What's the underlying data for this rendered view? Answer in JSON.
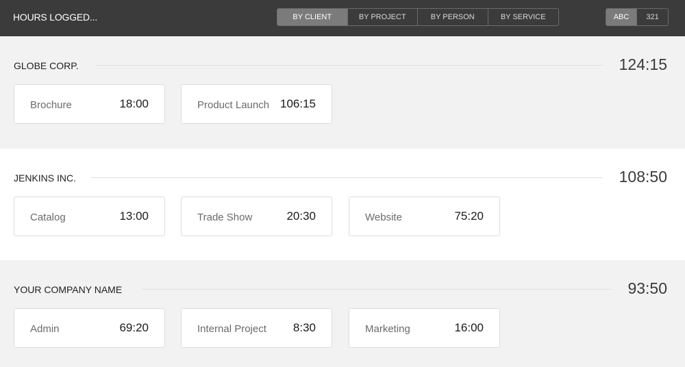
{
  "header": {
    "title": "HOURS LOGGED...",
    "view_tabs": [
      {
        "label": "BY CLIENT",
        "active": true
      },
      {
        "label": "BY PROJECT",
        "active": false
      },
      {
        "label": "BY PERSON",
        "active": false
      },
      {
        "label": "BY SERVICE",
        "active": false
      }
    ],
    "sort_tabs": [
      {
        "label": "ABC",
        "active": true
      },
      {
        "label": "321",
        "active": false
      }
    ]
  },
  "clients": [
    {
      "name": "GLOBE CORP.",
      "total": "124:15",
      "projects": [
        {
          "name": "Brochure",
          "hours": "18:00"
        },
        {
          "name": "Product Launch",
          "hours": "106:15"
        }
      ]
    },
    {
      "name": "JENKINS INC.",
      "total": "108:50",
      "projects": [
        {
          "name": "Catalog",
          "hours": "13:00"
        },
        {
          "name": "Trade Show",
          "hours": "20:30"
        },
        {
          "name": "Website",
          "hours": "75:20"
        }
      ]
    },
    {
      "name": "YOUR COMPANY NAME",
      "total": "93:50",
      "projects": [
        {
          "name": "Admin",
          "hours": "69:20"
        },
        {
          "name": "Internal Project",
          "hours": "8:30"
        },
        {
          "name": "Marketing",
          "hours": "16:00"
        }
      ]
    }
  ],
  "colors": {
    "topbar": "#3b3b3b",
    "active_tab": "#7b7b7b",
    "group_alt": "#f2f2f2",
    "card_bg": "#ffffff"
  }
}
